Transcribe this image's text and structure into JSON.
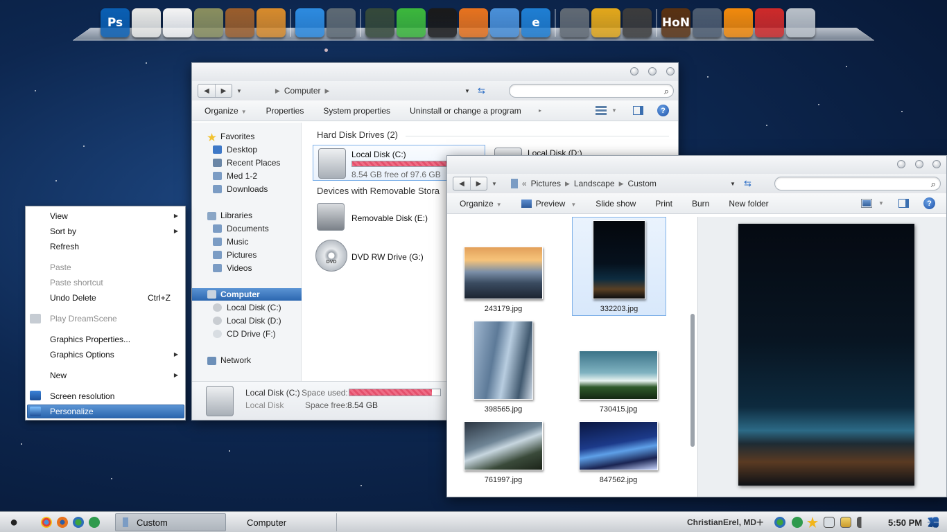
{
  "dock": {
    "icons": [
      {
        "name": "photoshop",
        "glyph": "Ps",
        "color": "#0a5fb3"
      },
      {
        "name": "notepad",
        "glyph": "",
        "color": "#e9e9e6"
      },
      {
        "name": "text-document",
        "glyph": "",
        "color": "#f5f5f5"
      },
      {
        "name": "retro-tv",
        "glyph": "",
        "color": "#8a8f5f"
      },
      {
        "name": "bookshelf",
        "glyph": "",
        "color": "#9b5e2c"
      },
      {
        "name": "book",
        "glyph": "",
        "color": "#d88b2c"
      },
      {
        "name": "browser-shield",
        "glyph": "",
        "color": "#2d8be0"
      },
      {
        "name": "windows-switcher",
        "glyph": "",
        "color": "#5e6a74"
      },
      {
        "name": "gauge-clock",
        "glyph": "",
        "color": "#35493a"
      },
      {
        "name": "chat-app",
        "glyph": "",
        "color": "#3cb83c"
      },
      {
        "name": "eclipse-orb",
        "glyph": "",
        "color": "#1a1a1a"
      },
      {
        "name": "firefox",
        "glyph": "",
        "color": "#e8731e"
      },
      {
        "name": "chrome",
        "glyph": "",
        "color": "#4a90d9"
      },
      {
        "name": "internet-explorer",
        "glyph": "e",
        "color": "#1f7fd4"
      },
      {
        "name": "tools",
        "glyph": "",
        "color": "#616a74"
      },
      {
        "name": "keys",
        "glyph": "",
        "color": "#e3a81b"
      },
      {
        "name": "webcam",
        "glyph": "",
        "color": "#3c3c3c"
      },
      {
        "name": "hon-game",
        "glyph": "HoN",
        "color": "#5a3212"
      },
      {
        "name": "warcraft-game",
        "glyph": "",
        "color": "#4d5c70"
      },
      {
        "name": "vlc",
        "glyph": "",
        "color": "#f28a0c"
      },
      {
        "name": "angry-birds",
        "glyph": "",
        "color": "#cf2a2a"
      },
      {
        "name": "recycle-bin",
        "glyph": "",
        "color": "#b9c0c8"
      }
    ]
  },
  "computer_window": {
    "breadcrumb": "Computer",
    "toolbar": [
      "Organize",
      "Properties",
      "System properties",
      "Uninstall or change a program"
    ],
    "nav": {
      "favorites": "Favorites",
      "favorites_items": [
        "Desktop",
        "Recent Places",
        "Med 1-2",
        "Downloads"
      ],
      "libraries": "Libraries",
      "libraries_items": [
        "Documents",
        "Music",
        "Pictures",
        "Videos"
      ],
      "computer": "Computer",
      "computer_items": [
        "Local Disk (C:)",
        "Local Disk (D:)",
        "CD Drive (F:)"
      ],
      "network": "Network"
    },
    "groups": {
      "hdd": "Hard Disk Drives (2)",
      "removable": "Devices with Removable Stora"
    },
    "drives": {
      "c_name": "Local Disk (C:)",
      "c_free": "8.54 GB free of 97.6 GB",
      "c_used_fraction": 0.91,
      "d_name": "Local Disk (D:)",
      "e_name": "Removable Disk (E:)",
      "g_name": "DVD RW Drive (G:)",
      "dvd_label": "DVD"
    },
    "details": {
      "name": "Local Disk (C:)",
      "type": "Local Disk",
      "used_label": "Space used:",
      "free_label": "Space free:",
      "free_value": "8.54 GB"
    }
  },
  "custom_window": {
    "breadcrumb": [
      "Pictures",
      "Landscape",
      "Custom"
    ],
    "crumb_prefix": "«",
    "toolbar": [
      "Organize",
      "Preview",
      "Slide show",
      "Print",
      "Burn",
      "New folder"
    ],
    "files": [
      "243179.jpg",
      "332203.jpg",
      "398565.jpg",
      "730415.jpg",
      "761997.jpg",
      "847562.jpg"
    ],
    "selected_file": "332203.jpg"
  },
  "context_menu": {
    "view": "View",
    "sort_by": "Sort by",
    "refresh": "Refresh",
    "paste": "Paste",
    "paste_shortcut": "Paste shortcut",
    "undo_delete": "Undo Delete",
    "undo_shortcut": "Ctrl+Z",
    "play_dreamscene": "Play DreamScene",
    "graphics_properties": "Graphics Properties...",
    "graphics_options": "Graphics Options",
    "new": "New",
    "screen_resolution": "Screen resolution",
    "personalize": "Personalize"
  },
  "taskbar": {
    "window_custom": "Custom",
    "window_computer": "Computer",
    "user": "ChristianErel, MD",
    "clock": "5:50 PM",
    "add_glyph": "+"
  },
  "colors": {
    "accent": "#2c67b0",
    "usage_bar": "#e4506c"
  }
}
